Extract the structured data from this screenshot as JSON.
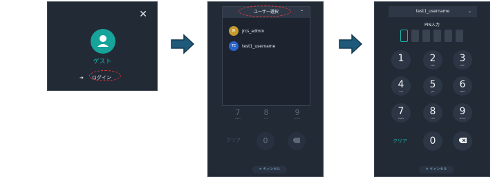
{
  "panel1": {
    "close_icon": "close-icon",
    "avatar_icon": "user-icon",
    "guest_label": "ゲスト",
    "login_icon": "login-icon",
    "login_label": "ログイン"
  },
  "panel2": {
    "dropdown_title": "ユーザー選択",
    "users": [
      {
        "initials": "JR",
        "name": "jrcs_admin",
        "color": "#c79a2e"
      },
      {
        "initials": "TE",
        "name": "test1_username",
        "color": "#2b63c9"
      }
    ],
    "keys_behind": [
      {
        "num": "7",
        "sub": "PQRS"
      },
      {
        "num": "8",
        "sub": "TUV"
      },
      {
        "num": "9",
        "sub": "WXYZ"
      }
    ],
    "clear_label": "クリア",
    "zero_label": "0",
    "cancel_label": "✕ キャンセル"
  },
  "panel3": {
    "selected_user": "test1_username",
    "pin_label": "PIN入力",
    "keys": [
      {
        "num": "1",
        "sub": ""
      },
      {
        "num": "2",
        "sub": "ABC"
      },
      {
        "num": "3",
        "sub": "DEF"
      },
      {
        "num": "4",
        "sub": "GHI"
      },
      {
        "num": "5",
        "sub": "JKL"
      },
      {
        "num": "6",
        "sub": "MNO"
      },
      {
        "num": "7",
        "sub": "PQRS"
      },
      {
        "num": "8",
        "sub": "TUV"
      },
      {
        "num": "9",
        "sub": "WXYZ"
      }
    ],
    "clear_label": "クリア",
    "zero_label": "0",
    "cancel_label": "✕ キャンセル"
  },
  "colors": {
    "accent": "#18b5a8",
    "panel_bg": "#222a36",
    "highlight": "#e23a3a",
    "arrow": "#1f5a7a"
  }
}
